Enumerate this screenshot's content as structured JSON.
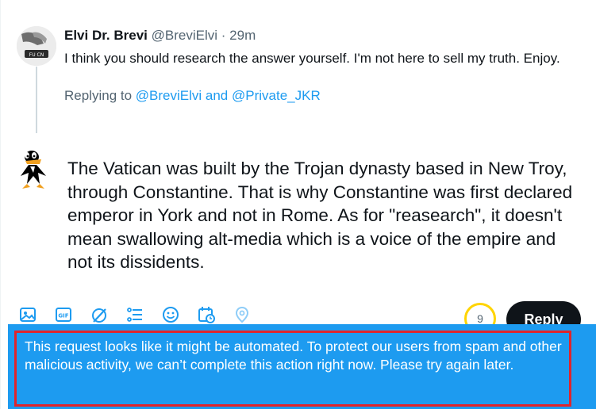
{
  "tweet": {
    "author_name": "Elvi Dr. Brevi",
    "author_handle": "@BreviElvi",
    "separator": "·",
    "timestamp": "29m",
    "text": "I think you should research the answer yourself. I'm not here to sell my truth. Enjoy.",
    "replying_prefix": "Replying to",
    "replying_to": "@BreviElvi and @Private_JKR",
    "avatar_label": "FU CN"
  },
  "compose": {
    "text": "The Vatican was built by the Trojan dynasty based in New Troy, through Constantine. That is why Constantine was first declared emperor in York and not in Rome. As for \"reasearch\", it doesn't mean swallowing alt-media which is a voice of the empire and not its dissidents."
  },
  "toolbar": {
    "icons": [
      "image-icon",
      "gif-icon",
      "grok-icon",
      "poll-icon",
      "emoji-icon",
      "schedule-icon",
      "location-icon"
    ],
    "char_counter": "9",
    "reply_label": "Reply",
    "accent_color": "#1d9bf0"
  },
  "toast": {
    "message": "This request looks like it might be automated. To protect our users from spam and other malicious activity, we can’t complete this action right now. Please try again later.",
    "background": "#1d9bf0",
    "highlight_color": "#e0242b"
  }
}
